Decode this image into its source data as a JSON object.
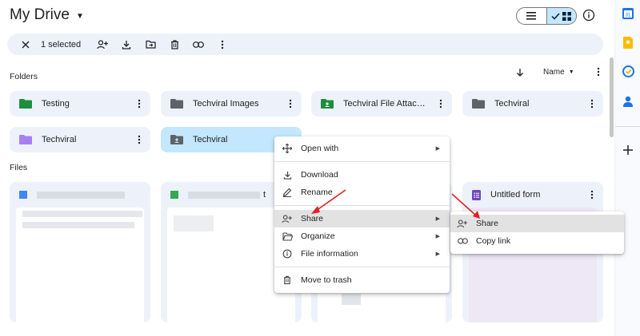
{
  "header": {
    "title": "My Drive"
  },
  "selection": {
    "count_label": "1 selected"
  },
  "sections": {
    "folders": "Folders",
    "files": "Files"
  },
  "sort": {
    "label": "Name"
  },
  "folders": [
    {
      "name": "Testing"
    },
    {
      "name": "Techviral Images"
    },
    {
      "name": "Techviral File Attachm..."
    },
    {
      "name": "Techviral"
    },
    {
      "name": "Techviral"
    },
    {
      "name": "Techviral"
    }
  ],
  "files": {
    "form_title": "Untitled form",
    "partial_name_suffix": "t"
  },
  "context_menu": {
    "items": [
      {
        "label": "Open with",
        "icon": "move-icon",
        "has_submenu": true
      },
      {
        "label": "Download",
        "icon": "download-icon"
      },
      {
        "label": "Rename",
        "icon": "pencil-icon"
      },
      {
        "label": "Share",
        "icon": "person-add-icon",
        "has_submenu": true
      },
      {
        "label": "Organize",
        "icon": "folder-open-icon",
        "has_submenu": true
      },
      {
        "label": "File information",
        "icon": "info-icon",
        "has_submenu": true
      },
      {
        "label": "Move to trash",
        "icon": "trash-icon"
      }
    ]
  },
  "share_submenu": {
    "items": [
      {
        "label": "Share",
        "icon": "person-add-icon"
      },
      {
        "label": "Copy link",
        "icon": "link-icon"
      }
    ]
  },
  "colors": {
    "accent": "#c2e7ff",
    "surface": "#edf2fa",
    "folder_green": "#1e8e3e",
    "folder_purple": "#a77ff0",
    "folder_gray": "#5f6368",
    "forms_purple": "#7248b9",
    "annotation_red": "#e02020"
  }
}
